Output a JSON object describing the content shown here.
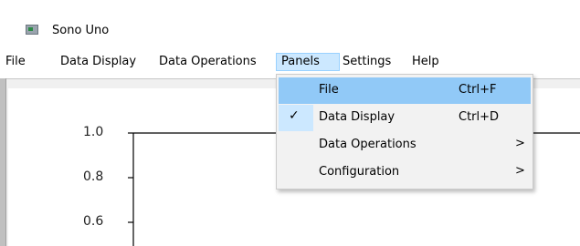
{
  "window": {
    "title": "Sono Uno",
    "icon": "app-window-icon"
  },
  "menubar": {
    "items": [
      {
        "label": "File"
      },
      {
        "label": "Data Display"
      },
      {
        "label": "Data Operations"
      },
      {
        "label": "Panels"
      },
      {
        "label": "Settings"
      },
      {
        "label": "Help"
      }
    ],
    "active": "Panels"
  },
  "panels_menu": {
    "items": [
      {
        "label": "File",
        "shortcut": "Ctrl+F",
        "checked": false,
        "highlighted": true,
        "submenu": false
      },
      {
        "label": "Data Display",
        "shortcut": "Ctrl+D",
        "checked": true,
        "highlighted": false,
        "submenu": false
      },
      {
        "label": "Data Operations",
        "shortcut": "",
        "checked": false,
        "highlighted": false,
        "submenu": true
      },
      {
        "label": "Configuration",
        "shortcut": "",
        "checked": false,
        "highlighted": false,
        "submenu": true
      }
    ],
    "check_glyph": "✓",
    "submenu_glyph": ">"
  },
  "plot": {
    "y_tick_labels": [
      "1.0",
      "0.8",
      "0.6"
    ]
  }
}
